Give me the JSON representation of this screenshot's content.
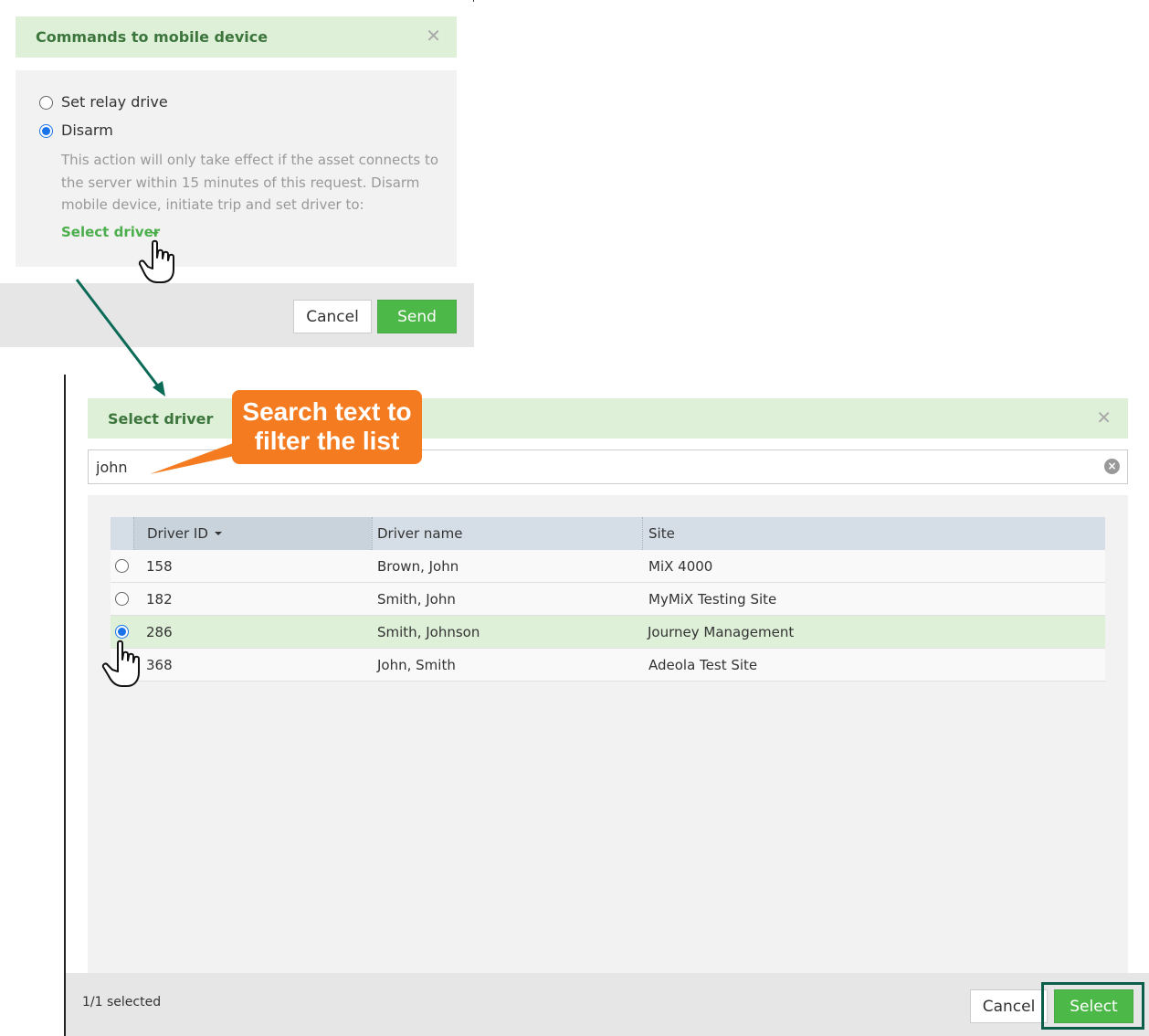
{
  "commands_dialog": {
    "title": "Commands to mobile device",
    "options": [
      {
        "label": "Set relay drive",
        "checked": false
      },
      {
        "label": "Disarm",
        "checked": true
      }
    ],
    "description": "This action will only take effect if the asset connects to the server within 15 minutes of this request. Disarm mobile device, initiate trip and set driver to:",
    "select_driver_link": "Select driver",
    "cancel_label": "Cancel",
    "send_label": "Send"
  },
  "select_driver_dialog": {
    "title": "Select driver",
    "search_value": "john",
    "columns": [
      "Driver ID",
      "Driver name",
      "Site"
    ],
    "sort_column": "Driver ID",
    "rows": [
      {
        "id": "158",
        "name": "Brown, John",
        "site": "MiX 4000",
        "selected": false
      },
      {
        "id": "182",
        "name": "Smith, John",
        "site": "MyMiX Testing Site",
        "selected": false
      },
      {
        "id": "286",
        "name": "Smith, Johnson",
        "site": "Journey Management",
        "selected": true
      },
      {
        "id": "368",
        "name": "John, Smith",
        "site": "Adeola Test Site",
        "selected": false
      }
    ],
    "selected_count": "1/1 selected",
    "cancel_label": "Cancel",
    "select_label": "Select"
  },
  "callout": {
    "text": "Search text to filter the list"
  },
  "colors": {
    "header_bg": "#dff0d8",
    "header_text": "#3c763d",
    "primary_button": "#4cb848",
    "callout": "#f47b20",
    "arrow": "#0b6b57",
    "radio_checked": "#1a73e8"
  }
}
